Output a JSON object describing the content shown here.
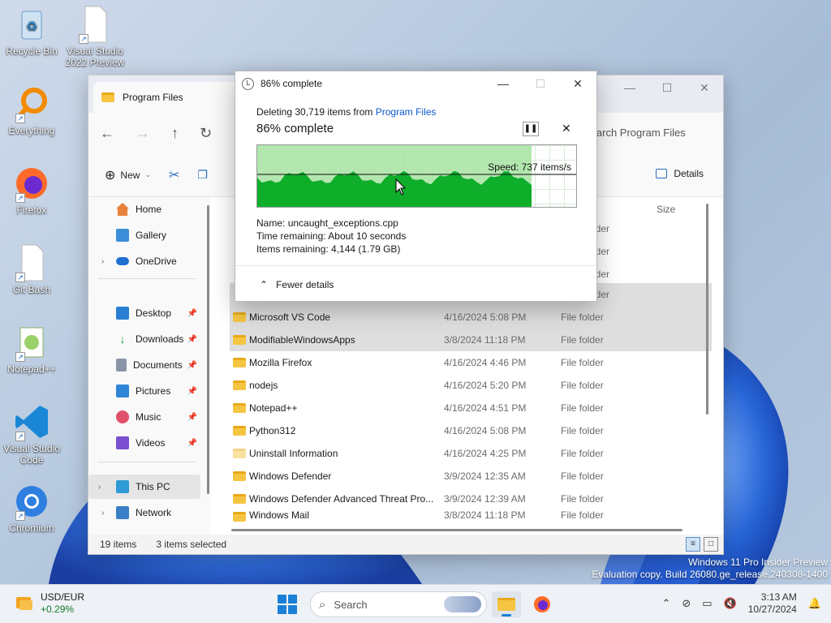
{
  "desktop": {
    "icons": [
      {
        "label": "Recycle Bin",
        "icon": "recycle-bin-icon"
      },
      {
        "label": "Visual Studio 2022 Preview",
        "icon": "document-icon"
      },
      {
        "label": "Everything",
        "icon": "everything-icon"
      },
      {
        "label": "Firefox",
        "icon": "firefox-icon"
      },
      {
        "label": "Git Bash",
        "icon": "document-icon"
      },
      {
        "label": "Notepad++",
        "icon": "notepadpp-icon"
      },
      {
        "label": "Visual Studio Code",
        "icon": "vscode-icon"
      },
      {
        "label": "Chromium",
        "icon": "chromium-icon"
      }
    ],
    "watermark_line1": "Windows 11 Pro Insider Preview",
    "watermark_line2": "Evaluation copy. Build 26080.ge_release.240308-1400"
  },
  "explorer": {
    "tab_title": "Program Files",
    "search_placeholder": "Search Program Files",
    "toolbar": {
      "new_label": "New",
      "details_label": "Details"
    },
    "sidebar": {
      "home": "Home",
      "gallery": "Gallery",
      "onedrive": "OneDrive",
      "desktop": "Desktop",
      "downloads": "Downloads",
      "documents": "Documents",
      "pictures": "Pictures",
      "music": "Music",
      "videos": "Videos",
      "thispc": "This PC",
      "network": "Network"
    },
    "column_size": "Size",
    "partial_type": "lder",
    "rows": [
      {
        "name": "Microsoft VS Code",
        "date": "4/16/2024 5:08 PM",
        "type": "File folder",
        "selected": true
      },
      {
        "name": "ModifiableWindowsApps",
        "date": "3/8/2024 11:18 PM",
        "type": "File folder",
        "selected": true
      },
      {
        "name": "Mozilla Firefox",
        "date": "4/16/2024 4:46 PM",
        "type": "File folder",
        "selected": false
      },
      {
        "name": "nodejs",
        "date": "4/16/2024 5:20 PM",
        "type": "File folder",
        "selected": false
      },
      {
        "name": "Notepad++",
        "date": "4/16/2024 4:51 PM",
        "type": "File folder",
        "selected": false
      },
      {
        "name": "Python312",
        "date": "4/16/2024 5:08 PM",
        "type": "File folder",
        "selected": false
      },
      {
        "name": "Uninstall Information",
        "date": "4/16/2024 4:25 PM",
        "type": "File folder",
        "selected": false
      },
      {
        "name": "Windows Defender",
        "date": "3/9/2024 12:35 AM",
        "type": "File folder",
        "selected": false
      },
      {
        "name": "Windows Defender Advanced Threat Pro...",
        "date": "3/9/2024 12:39 AM",
        "type": "File folder",
        "selected": false
      },
      {
        "name": "Windows Mail",
        "date": "3/8/2024 11:18 PM",
        "type": "File folder",
        "selected": false
      }
    ],
    "status_items": "19 items",
    "status_selected": "3 items selected"
  },
  "dialog": {
    "title": "86% complete",
    "deleting_prefix": "Deleting 30,719 items from ",
    "deleting_link": "Program Files",
    "heading": "86% complete",
    "progress": 0.86,
    "speed": "Speed: 737 items/s",
    "name_label": "Name:",
    "name_value": "uncaught_exceptions.cpp",
    "time_label": "Time remaining:",
    "time_value": "About 10 seconds",
    "items_label": "Items remaining:",
    "items_value": "4,144 (1.79 GB)",
    "fewer_details": "Fewer details"
  },
  "taskbar": {
    "widget_title": "USD/EUR",
    "widget_change": "+0.29%",
    "search_placeholder": "Search",
    "time": "3:13 AM",
    "date": "10/27/2024"
  },
  "colors": {
    "accent": "#1a7fd6",
    "progress_green": "#0ead2a",
    "progress_light": "#a6e3a1",
    "link": "#0a58ca"
  }
}
